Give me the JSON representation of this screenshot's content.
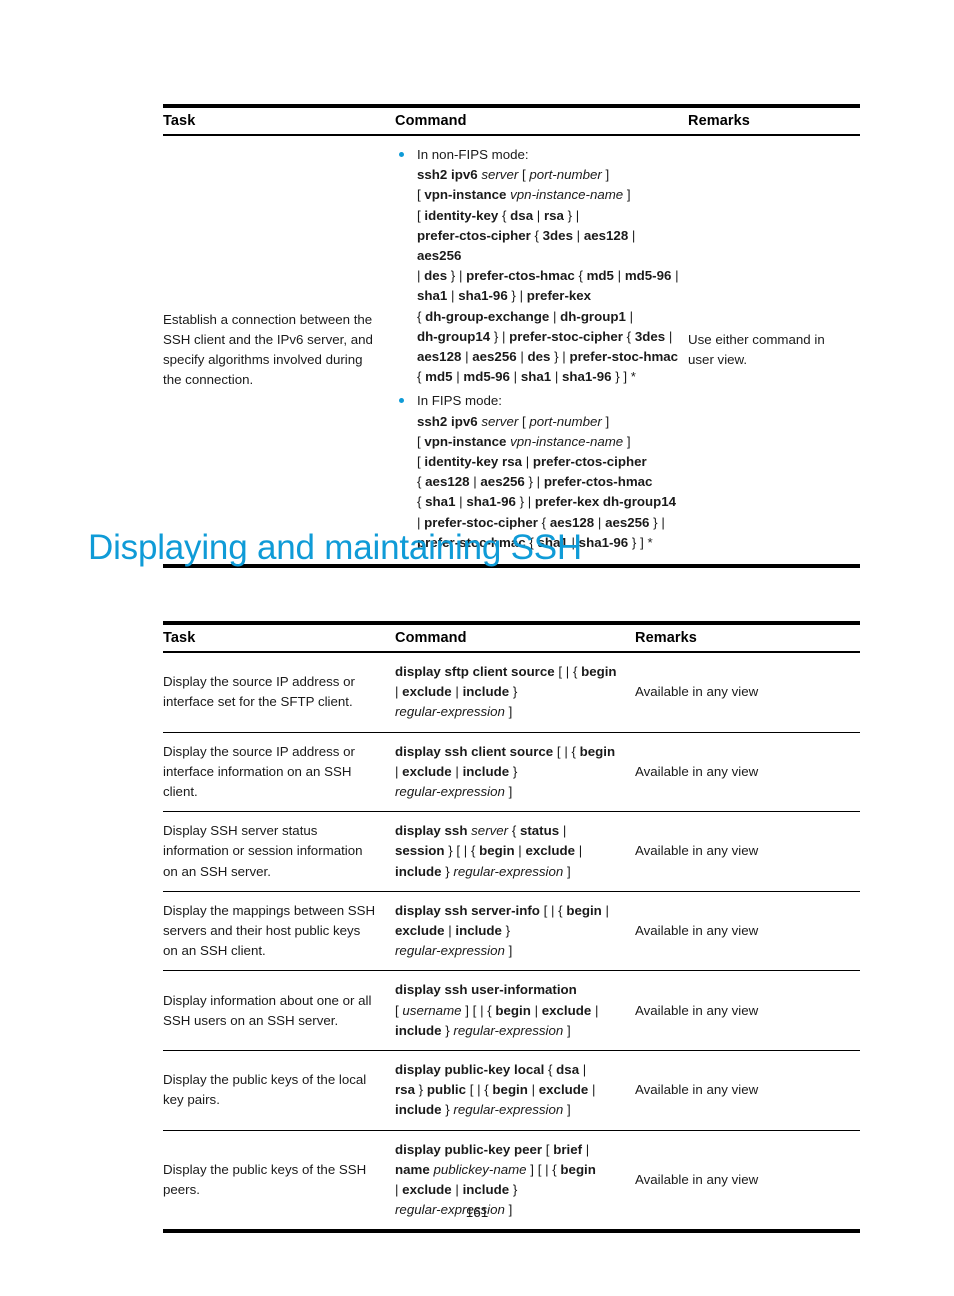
{
  "page": {
    "number": "161"
  },
  "heading": {
    "text": "Displaying and maintaining SSH",
    "color": "#0f9bd7"
  },
  "bullet_color": "#0f9bd7",
  "table_ssh_ipv6": {
    "headers": {
      "task": "Task",
      "command": "Command",
      "remarks": "Remarks"
    },
    "rows": [
      {
        "task": "Establish a connection between the SSH client and the IPv6 server, and specify algorithms involved during the connection.",
        "command_bullets": [
          {
            "lead": "In non-FIPS mode:",
            "lines": [
              "ssh2 ipv6 server [ port-number ]",
              "[ vpn-instance vpn-instance-name ]",
              "[ identity-key { dsa | rsa } |",
              "prefer-ctos-cipher { 3des | aes128 | aes256",
              "| des } | prefer-ctos-hmac { md5 | md5-96 |",
              "sha1 | sha1-96 } | prefer-kex",
              "{ dh-group-exchange | dh-group1 |",
              "dh-group14 } | prefer-stoc-cipher { 3des |",
              "aes128 | aes256 | des } | prefer-stoc-hmac",
              "{ md5 | md5-96 | sha1 | sha1-96 } ] *"
            ]
          },
          {
            "lead": "In FIPS mode:",
            "lines": [
              "ssh2 ipv6 server [ port-number ]",
              "[ vpn-instance vpn-instance-name ]",
              "[ identity-key rsa | prefer-ctos-cipher",
              "{ aes128 | aes256 } | prefer-ctos-hmac",
              "{ sha1 | sha1-96 } | prefer-kex dh-group14",
              "| prefer-stoc-cipher { aes128 | aes256 } |",
              "prefer-stoc-hmac { sha1 | sha1-96 } ] *"
            ]
          }
        ],
        "remarks": "Use either command in user view."
      }
    ]
  },
  "table_display": {
    "headers": {
      "task": "Task",
      "command": "Command",
      "remarks": "Remarks"
    },
    "rows": [
      {
        "task": "Display the source IP address or interface set for the SFTP client.",
        "command_lines": [
          "display sftp client source [ | { begin",
          "| exclude | include }",
          "regular-expression ]"
        ],
        "remarks": "Available in any view"
      },
      {
        "task": "Display the source IP address or interface information on an SSH client.",
        "command_lines": [
          "display ssh client source [ | { begin",
          "| exclude | include }",
          "regular-expression ]"
        ],
        "remarks": "Available in any view"
      },
      {
        "task": "Display SSH server status information or session information on an SSH server.",
        "command_lines": [
          "display ssh server { status |",
          "session } [ | { begin | exclude |",
          "include } regular-expression ]"
        ],
        "remarks": "Available in any view"
      },
      {
        "task": "Display the mappings between SSH servers and their host public keys on an SSH client.",
        "command_lines": [
          "display ssh server-info [ | { begin |",
          "exclude | include }",
          "regular-expression ]"
        ],
        "remarks": "Available in any view"
      },
      {
        "task": "Display information about one or all SSH users on an SSH server.",
        "command_lines": [
          "display ssh user-information",
          "[ username ] [ | { begin | exclude |",
          "include } regular-expression ]"
        ],
        "remarks": "Available in any view"
      },
      {
        "task": "Display the public keys of the local key pairs.",
        "command_lines": [
          "display public-key local { dsa |",
          "rsa } public [ | { begin | exclude |",
          "include } regular-expression ]"
        ],
        "remarks": "Available in any view"
      },
      {
        "task": "Display the public keys of the SSH peers.",
        "command_lines": [
          "display public-key peer [ brief |",
          "name publickey-name ] [ | { begin",
          "| exclude | include }",
          "regular-expression ]"
        ],
        "remarks": "Available in any view"
      }
    ]
  }
}
